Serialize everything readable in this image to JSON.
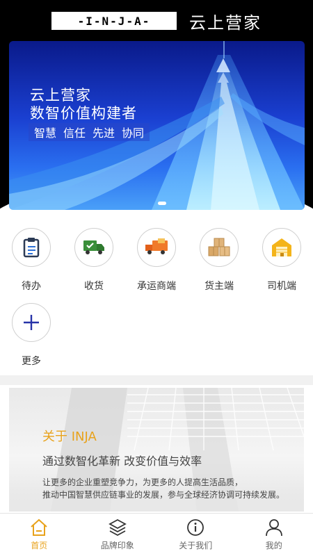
{
  "header": {
    "logo_text": "-I-N-J-A-",
    "brand_name": "云上营家"
  },
  "banner": {
    "title_line1": "云上营家",
    "title_line2": "数智价值构建者",
    "tags": [
      "智慧",
      "信任",
      "先进",
      "协同"
    ]
  },
  "actions": [
    {
      "label": "待办",
      "icon": "clipboard-icon"
    },
    {
      "label": "收货",
      "icon": "delivery-truck-icon"
    },
    {
      "label": "承运商端",
      "icon": "orange-truck-icon"
    },
    {
      "label": "货主端",
      "icon": "boxes-icon"
    },
    {
      "label": "司机端",
      "icon": "warehouse-icon"
    },
    {
      "label": "更多",
      "icon": "plus-icon"
    }
  ],
  "about": {
    "title": "关于 INJA",
    "subtitle": "通过数智化革新 改变价值与效率",
    "line1": "让更多的企业重塑竞争力，为更多的人提高生活品质，",
    "line2": "推动中国智慧供应链事业的发展，参与全球经济协调可持续发展。"
  },
  "bottom_nav": [
    {
      "label": "首页",
      "icon": "home-icon",
      "active": true
    },
    {
      "label": "品牌印象",
      "icon": "layers-icon",
      "active": false
    },
    {
      "label": "关于我们",
      "icon": "info-icon",
      "active": false
    },
    {
      "label": "我的",
      "icon": "user-icon",
      "active": false
    }
  ],
  "colors": {
    "accent": "#e8a21b",
    "header_bg": "#000000",
    "banner_blue": "#1a3fd0"
  }
}
